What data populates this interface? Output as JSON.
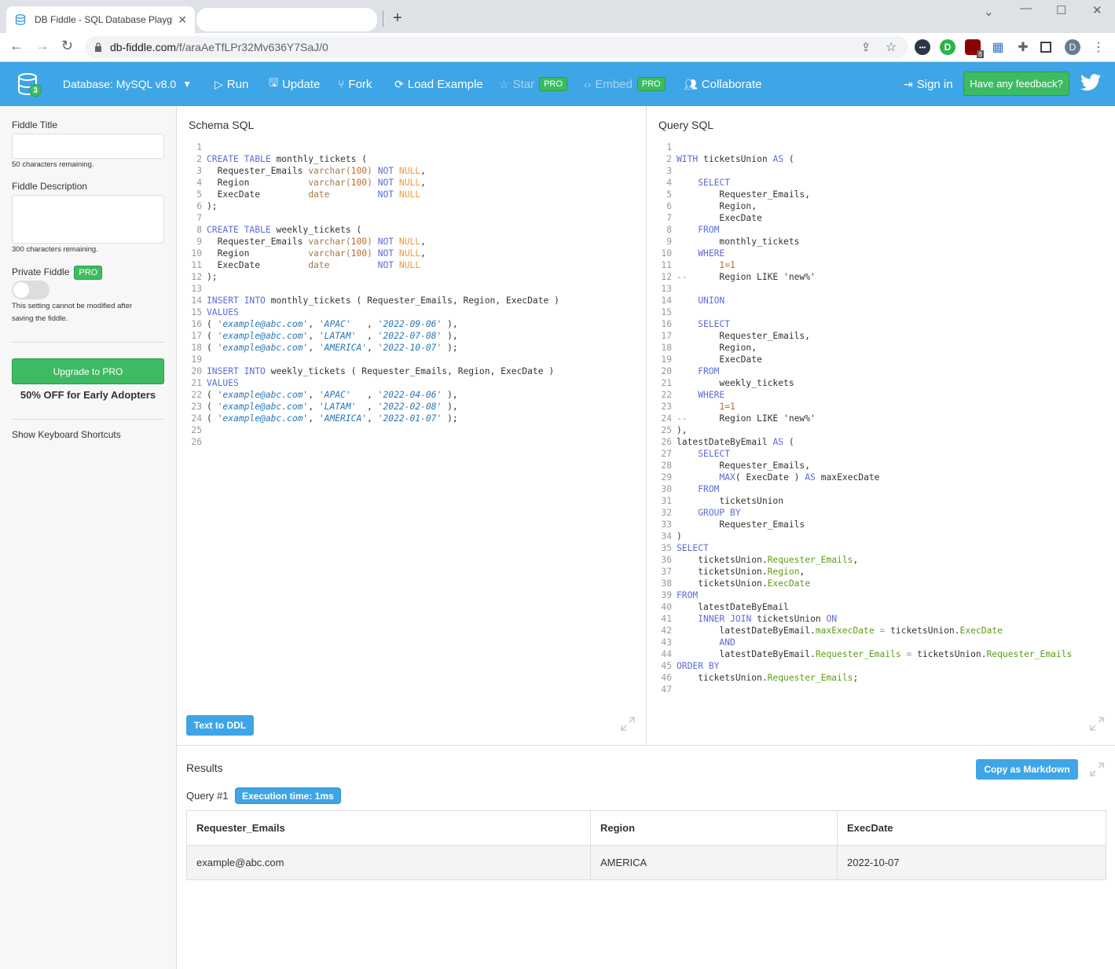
{
  "browser": {
    "tab_title": "DB Fiddle - SQL Database Playground",
    "url_host": "db-fiddle.com",
    "url_path": "/f/araAeTfLPr32Mv636Y7SaJ/0",
    "profile_initial": "D",
    "extension_badge": "8"
  },
  "header": {
    "database_label": "Database: MySQL v8.0",
    "db_count_badge": "3",
    "run": "Run",
    "update": "Update",
    "fork": "Fork",
    "load_example": "Load Example",
    "star": "Star",
    "embed": "Embed",
    "pro_badge": "PRO",
    "collaborate": "Collaborate",
    "sign_in": "Sign in",
    "feedback": "Have any feedback?"
  },
  "sidebar": {
    "title_label": "Fiddle Title",
    "title_value": "",
    "title_remaining": "50 characters remaining.",
    "description_label": "Fiddle Description",
    "description_value": "",
    "description_remaining": "300 characters remaining.",
    "private_label": "Private Fiddle",
    "private_enabled": false,
    "private_note_1": "This setting cannot be modified after",
    "private_note_2": "saving the fiddle.",
    "upgrade_button": "Upgrade to PRO",
    "offer": "50% OFF for Early Adopters",
    "shortcuts": "Show Keyboard Shortcuts"
  },
  "schema": {
    "title": "Schema SQL",
    "text_to_ddl": "Text to DDL",
    "lines": [
      "",
      "CREATE TABLE monthly_tickets (",
      "  Requester_Emails varchar(100) NOT NULL,",
      "  Region           varchar(100) NOT NULL,",
      "  ExecDate         date         NOT NULL",
      ");",
      "",
      "CREATE TABLE weekly_tickets (",
      "  Requester_Emails varchar(100) NOT NULL,",
      "  Region           varchar(100) NOT NULL,",
      "  ExecDate         date         NOT NULL",
      ");",
      "",
      "INSERT INTO monthly_tickets ( Requester_Emails, Region, ExecDate )",
      "VALUES",
      "( 'example@abc.com', 'APAC'   , '2022-09-06' ),",
      "( 'example@abc.com', 'LATAM'  , '2022-07-08' ),",
      "( 'example@abc.com', 'AMERICA', '2022-10-07' );",
      "",
      "INSERT INTO weekly_tickets ( Requester_Emails, Region, ExecDate )",
      "VALUES",
      "( 'example@abc.com', 'APAC'   , '2022-04-06' ),",
      "( 'example@abc.com', 'LATAM'  , '2022-02-08' ),",
      "( 'example@abc.com', 'AMERICA', '2022-01-07' );",
      "",
      ""
    ]
  },
  "query": {
    "title": "Query SQL",
    "lines": [
      "",
      "WITH ticketsUnion AS (",
      "",
      "    SELECT",
      "        Requester_Emails,",
      "        Region,",
      "        ExecDate",
      "    FROM",
      "        monthly_tickets",
      "    WHERE",
      "        1=1",
      "--      Region LIKE 'new%'",
      "",
      "    UNION",
      "",
      "    SELECT",
      "        Requester_Emails,",
      "        Region,",
      "        ExecDate",
      "    FROM",
      "        weekly_tickets",
      "    WHERE",
      "        1=1",
      "--      Region LIKE 'new%'",
      "),",
      "latestDateByEmail AS (",
      "    SELECT",
      "        Requester_Emails,",
      "        MAX( ExecDate ) AS maxExecDate",
      "    FROM",
      "        ticketsUnion",
      "    GROUP BY",
      "        Requester_Emails",
      ")",
      "SELECT",
      "    ticketsUnion.Requester_Emails,",
      "    ticketsUnion.Region,",
      "    ticketsUnion.ExecDate",
      "FROM",
      "    latestDateByEmail",
      "    INNER JOIN ticketsUnion ON",
      "        latestDateByEmail.maxExecDate = ticketsUnion.ExecDate",
      "        AND",
      "        latestDateByEmail.Requester_Emails = ticketsUnion.Requester_Emails",
      "ORDER BY",
      "    ticketsUnion.Requester_Emails;",
      ""
    ]
  },
  "results": {
    "title": "Results",
    "copy_markdown": "Copy as Markdown",
    "query_label": "Query #1",
    "execution_time": "Execution time: 1ms",
    "columns": [
      "Requester_Emails",
      "Region",
      "ExecDate"
    ],
    "rows": [
      [
        "example@abc.com",
        "AMERICA",
        "2022-10-07"
      ]
    ]
  },
  "colors": {
    "brand_blue": "#3ea5e6",
    "pro_green": "#3dbb62"
  }
}
